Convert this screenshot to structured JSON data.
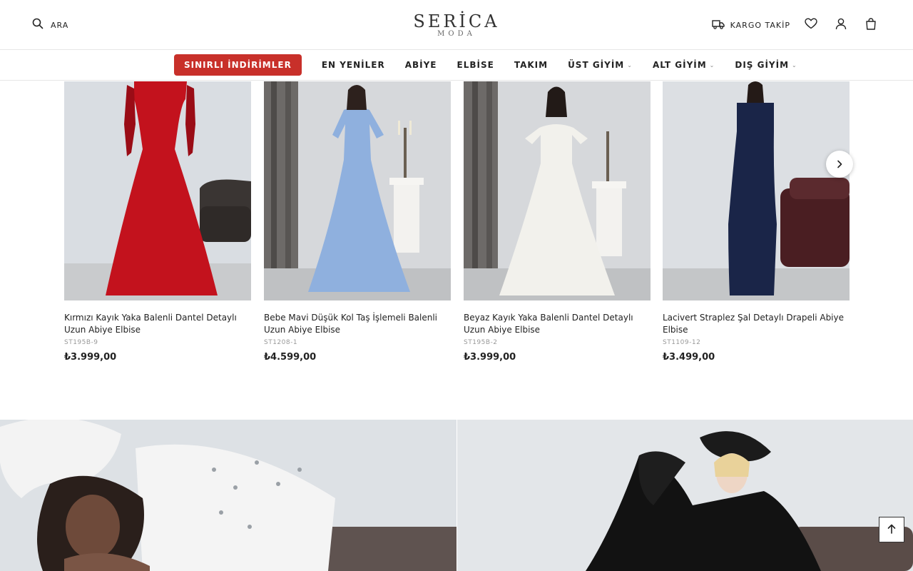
{
  "header": {
    "search_label": "ARA",
    "logo_brand": "SERİCA",
    "logo_sub": "MODA",
    "kargo_label": "KARGO TAKİP"
  },
  "nav": {
    "sale_label": "SINIRLI İNDİRİMLER",
    "items": [
      {
        "label": "EN YENİLER",
        "dropdown": false
      },
      {
        "label": "ABİYE",
        "dropdown": false
      },
      {
        "label": "ELBİSE",
        "dropdown": false
      },
      {
        "label": "TAKIM",
        "dropdown": false
      },
      {
        "label": "ÜST GİYİM",
        "dropdown": true
      },
      {
        "label": "ALT GİYİM",
        "dropdown": true
      },
      {
        "label": "DIŞ GİYİM",
        "dropdown": true
      }
    ]
  },
  "products": [
    {
      "name": "Kırmızı Kayık Yaka Balenli Dantel Detaylı Uzun Abiye Elbise",
      "sku": "ST195B-9",
      "price": "₺3.999,00",
      "dress_color": "#c3121d"
    },
    {
      "name": "Bebe Mavi Düşük Kol Taş İşlemeli Balenli Uzun Abiye Elbise",
      "sku": "ST1208-1",
      "price": "₺4.599,00",
      "dress_color": "#8fb0de"
    },
    {
      "name": "Beyaz Kayık Yaka Balenli Dantel Detaylı Uzun Abiye Elbise",
      "sku": "ST195B-2",
      "price": "₺3.999,00",
      "dress_color": "#f2f1ec"
    },
    {
      "name": "Lacivert Straplez Şal Detaylı Drapeli Abiye Elbise",
      "sku": "ST1109-12",
      "price": "₺3.499,00",
      "dress_color": "#1a2548"
    }
  ],
  "icons": {
    "search": "search-icon",
    "truck": "truck-icon",
    "heart": "heart-icon",
    "user": "user-icon",
    "bag": "bag-icon",
    "next": "chevron-right-icon",
    "top": "arrow-up-icon"
  },
  "colors": {
    "sale": "#c8302a"
  }
}
